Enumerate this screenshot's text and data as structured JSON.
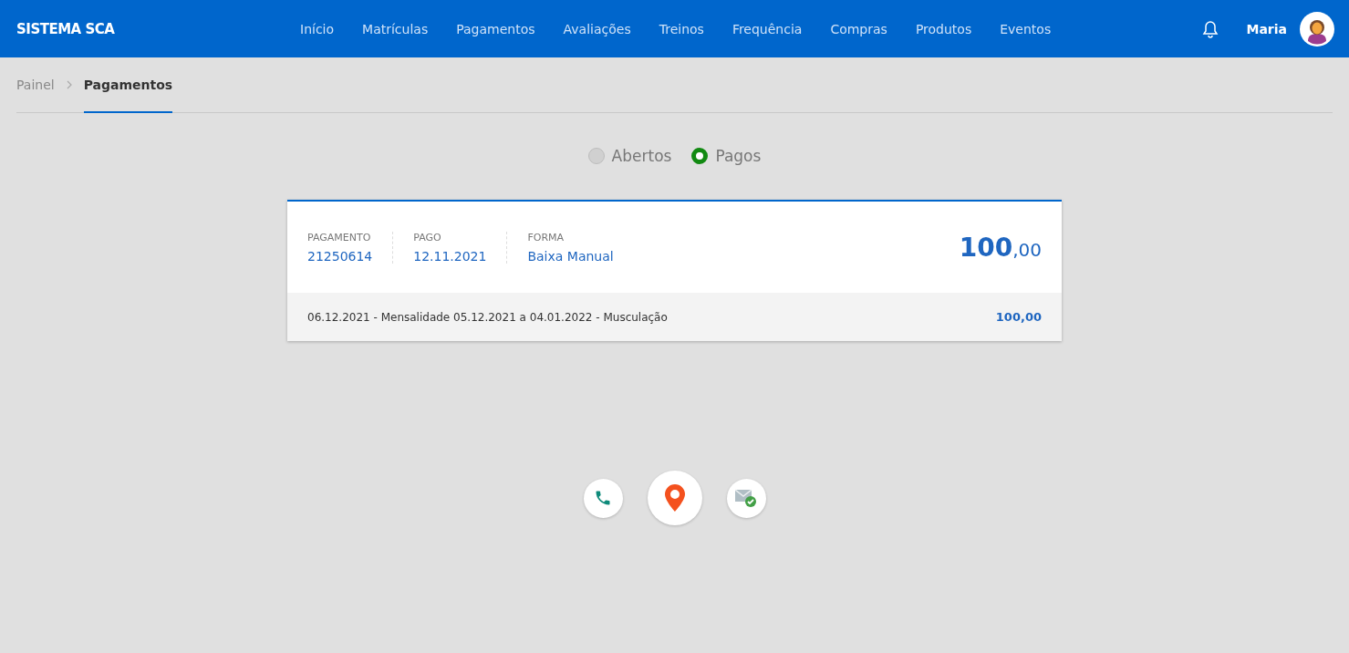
{
  "header": {
    "brand": "SISTEMA SCA",
    "nav": [
      {
        "label": "Início",
        "selected": false
      },
      {
        "label": "Matrículas",
        "selected": false
      },
      {
        "label": "Pagamentos",
        "selected": false
      },
      {
        "label": "Avaliações",
        "selected": false
      },
      {
        "label": "Treinos",
        "selected": false
      },
      {
        "label": "Frequência",
        "selected": false
      },
      {
        "label": "Compras",
        "selected": false
      },
      {
        "label": "Produtos",
        "selected": false
      },
      {
        "label": "Eventos",
        "selected": false
      }
    ],
    "user": "Maria"
  },
  "breadcrumb": [
    {
      "label": "Painel",
      "selected": false
    },
    {
      "label": "Pagamentos",
      "selected": true
    }
  ],
  "filter": [
    {
      "label": "Abertos",
      "selected": false
    },
    {
      "label": "Pagos",
      "selected": true
    }
  ],
  "payment": {
    "fields": [
      {
        "label": "PAGAMENTO",
        "value": "21250614"
      },
      {
        "label": "PAGO",
        "value": "12.11.2021"
      },
      {
        "label": "FORMA",
        "value": "Baixa Manual"
      }
    ],
    "amount": "**100**,00",
    "items": [
      {
        "description": "06.12.2021 - Mensalidade 05.12.2021 a 04.01.2022 - Musculação",
        "value": "100,00"
      }
    ]
  },
  "contact_buttons": [
    {
      "kind": "phone"
    },
    {
      "kind": "location"
    },
    {
      "kind": "email"
    }
  ]
}
